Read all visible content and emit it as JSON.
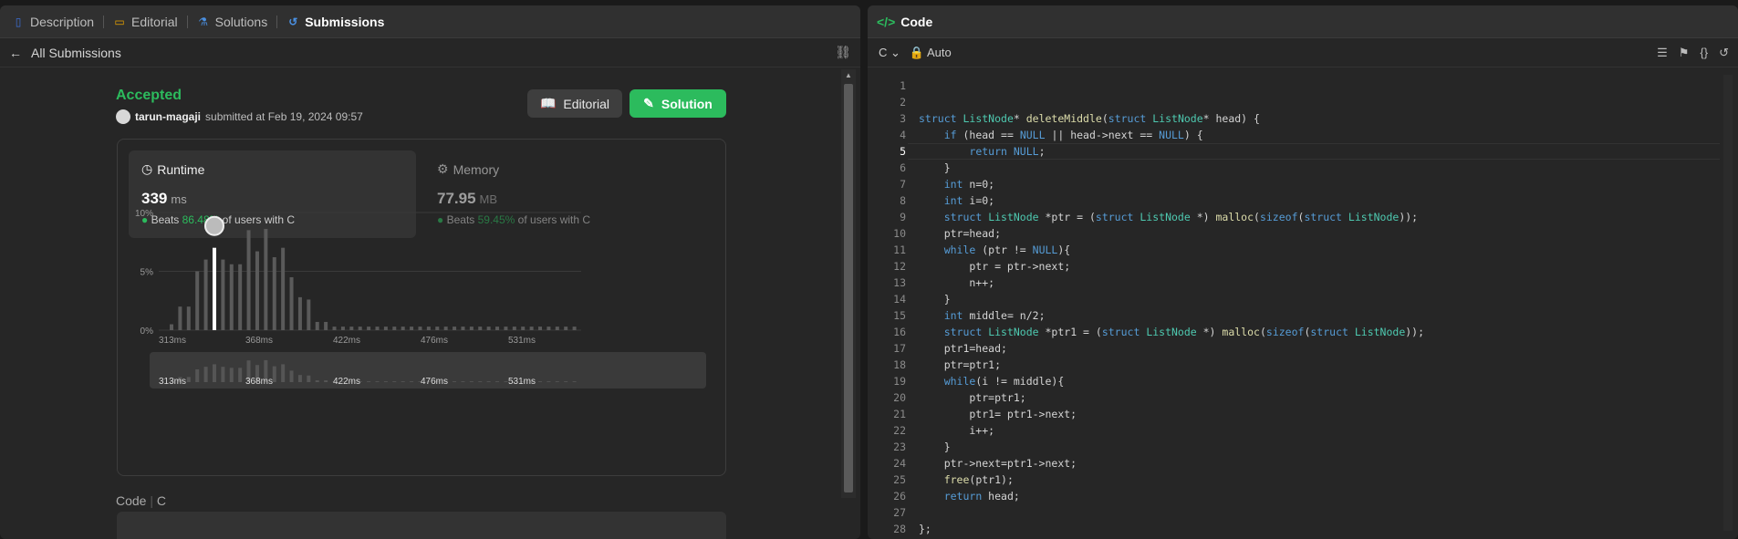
{
  "left_tabs": [
    {
      "label": "Description",
      "icon": "document-icon"
    },
    {
      "label": "Editorial",
      "icon": "book-icon"
    },
    {
      "label": "Solutions",
      "icon": "flask-icon"
    },
    {
      "label": "Submissions",
      "icon": "history-icon"
    }
  ],
  "subbar": {
    "back_label": "All Submissions"
  },
  "result": {
    "status": "Accepted",
    "username": "tarun-magaji",
    "submitted_text": "submitted at Feb 19, 2024 09:57",
    "editorial_btn": "Editorial",
    "solution_btn": "Solution"
  },
  "runtime": {
    "label": "Runtime",
    "value": "339",
    "unit": "ms",
    "beats_prefix": "Beats",
    "beats_pct": "86.48%",
    "beats_suffix": "of users with C"
  },
  "memory": {
    "label": "Memory",
    "value": "77.95",
    "unit": "MB",
    "beats_prefix": "Beats",
    "beats_pct": "59.45%",
    "beats_suffix": "of users with C"
  },
  "chart_data": {
    "type": "bar",
    "ylim": [
      0,
      10
    ],
    "y_ticks": [
      "10%",
      "5%",
      "0%"
    ],
    "x_ticks": [
      "313ms",
      "368ms",
      "422ms",
      "476ms",
      "531ms"
    ],
    "highlight_index": 5,
    "values": [
      0.5,
      2,
      2,
      5,
      6,
      7,
      6,
      5.6,
      5.6,
      8.5,
      6.7,
      8.6,
      6.2,
      7,
      4.5,
      2.8,
      2.6,
      0.7,
      0.7,
      0.3,
      0.3,
      0.3,
      0.3,
      0.3,
      0.3,
      0.3,
      0.3,
      0.3,
      0.3,
      0.3,
      0.3,
      0.3,
      0.3,
      0.3,
      0.3,
      0.3,
      0.3,
      0.3,
      0.3,
      0.3,
      0.3,
      0.3,
      0.3,
      0.3,
      0.3,
      0.3,
      0.3,
      0.3
    ]
  },
  "code_section": {
    "label": "Code",
    "lang": "C"
  },
  "right": {
    "title": "Code",
    "language": "C",
    "mode": "Auto",
    "current_line": 5,
    "lines": [
      "",
      "",
      "struct ListNode* deleteMiddle(struct ListNode* head) {",
      "    if (head == NULL || head->next == NULL) {",
      "        return NULL;",
      "    }",
      "    int n=0;",
      "    int i=0;",
      "    struct ListNode *ptr = (struct ListNode *) malloc(sizeof(struct ListNode));",
      "    ptr=head;",
      "    while (ptr != NULL){",
      "        ptr = ptr->next;",
      "        n++;",
      "    }",
      "    int middle= n/2;",
      "    struct ListNode *ptr1 = (struct ListNode *) malloc(sizeof(struct ListNode));",
      "    ptr1=head;",
      "    ptr=ptr1;",
      "    while(i != middle){",
      "        ptr=ptr1;",
      "        ptr1= ptr1->next;",
      "        i++;",
      "    }",
      "    ptr->next=ptr1->next;",
      "    free(ptr1);",
      "    return head;",
      "",
      "};"
    ]
  }
}
